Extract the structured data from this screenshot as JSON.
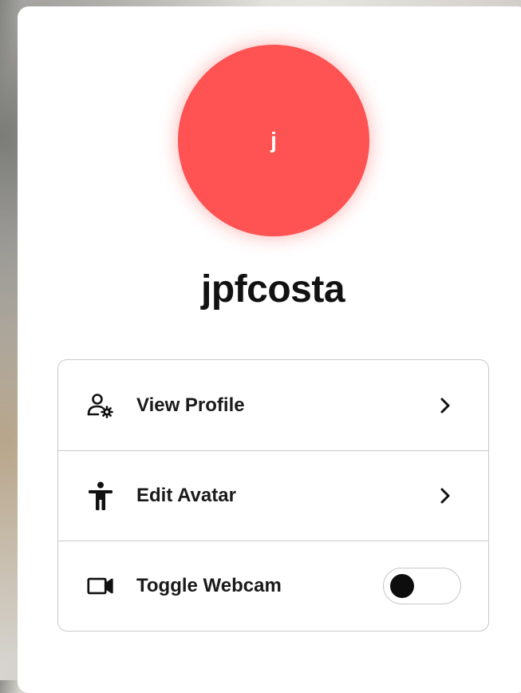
{
  "profile": {
    "avatar_letter": "j",
    "avatar_color": "#ff5252",
    "username": "jpfcosta"
  },
  "menu": {
    "items": [
      {
        "label": "View Profile",
        "icon": "user-settings-icon",
        "trailing": "chevron-right-icon"
      },
      {
        "label": "Edit Avatar",
        "icon": "person-standing-icon",
        "trailing": "chevron-right-icon"
      },
      {
        "label": "Toggle Webcam",
        "icon": "video-camera-icon",
        "trailing": "toggle-switch",
        "toggle_on": false
      }
    ]
  }
}
